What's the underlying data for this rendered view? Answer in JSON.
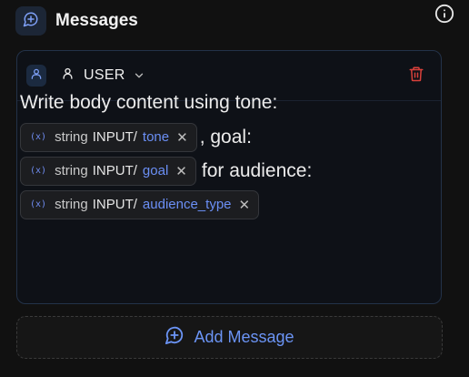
{
  "header": {
    "title": "Messages",
    "icon": "message-plus-icon"
  },
  "message": {
    "role_label": "USER",
    "role_icon": "user-icon",
    "delete_icon": "trash-icon",
    "text_intro": "Write body content using tone:",
    "chips": [
      {
        "icon": "variable-icon",
        "type": "string",
        "source": "INPUT/",
        "name": "tone",
        "after": ", goal:"
      },
      {
        "icon": "variable-icon",
        "type": "string",
        "source": "INPUT/",
        "name": "goal",
        "after": "for audience:"
      },
      {
        "icon": "variable-icon",
        "type": "string",
        "source": "INPUT/",
        "name": "audience_type",
        "after": ""
      }
    ]
  },
  "add_button": {
    "label": "Add Message",
    "icon": "message-plus-icon"
  },
  "colors": {
    "accent": "#6b8ff5",
    "danger": "#d9413b",
    "background": "#111111"
  }
}
